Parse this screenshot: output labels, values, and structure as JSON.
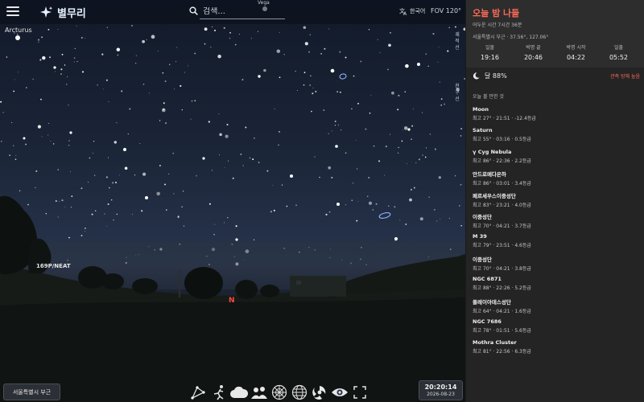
{
  "header": {
    "app_name": "별무리",
    "search_placeholder": "검색...",
    "language": "한국어",
    "fov": "FOV 120°",
    "menu_icon": "hamburger-icon",
    "logo_icon": "sparkle-icon",
    "search_icon": "search-icon",
    "language_icon": "translate-icon"
  },
  "sky": {
    "labels": {
      "arcturus": "Arcturus",
      "comet": "169P/NEAT",
      "vega": "Vega",
      "north": "N"
    },
    "right_edge_text": [
      "궤",
      "적",
      "선",
      "",
      "",
      "",
      "",
      "",
      "천",
      "구",
      "선"
    ]
  },
  "bottom": {
    "location_button": "서울특별시 부근",
    "clock_time": "20:20:14",
    "clock_date": "2026-08-23",
    "toolbar_icons": [
      "constellation-lines-icon",
      "constellation-art-icon",
      "atmosphere-icon",
      "landscape-icon",
      "azimuthal-grid-icon",
      "equatorial-grid-icon",
      "deep-sky-icon",
      "visibility-eye-icon",
      "fullscreen-icon"
    ]
  },
  "panel": {
    "title": "오늘 밤 나들",
    "dark_duration": "어두운 시간 7시간 36분",
    "location_coords": "서울특별시 부근 · 37.56°, 127.06°",
    "times": [
      {
        "label": "일몰",
        "value": "19:16"
      },
      {
        "label": "박명 끝",
        "value": "20:46"
      },
      {
        "label": "박명 시작",
        "value": "04:22"
      },
      {
        "label": "일출",
        "value": "05:52"
      }
    ],
    "moon_icon": "crescent-moon-icon",
    "moon_text": "달 88%",
    "observation_tips": "관측 방해 높음",
    "objects_header": "오늘 볼 만한 것",
    "objects": [
      {
        "name": "Moon",
        "detail": "최고 27° · 21:51 · -12.4등급"
      },
      {
        "name": "Saturn",
        "detail": "최고 55° · 03:16 · 0.5등급"
      },
      {
        "name": "γ Cyg Nebula",
        "detail": "최고 86° · 22:36 · 2.2등급"
      },
      {
        "name": "안드로메다은하",
        "detail": "최고 86° · 03:01 · 3.4등급"
      },
      {
        "name": "페르세우스이중성단",
        "detail": "최고 83° · 23:21 · 4.0등급"
      },
      {
        "name": "이중성단",
        "detail": "최고 70° · 04:21 · 3.7등급"
      },
      {
        "name": "M 39",
        "detail": "최고 79° · 23:51 · 4.6등급"
      },
      {
        "name": "이중성단",
        "detail": "최고 70° · 04:21 · 3.8등급"
      },
      {
        "name": "NGC 6871",
        "detail": "최고 88° · 22:26 · 5.2등급"
      },
      {
        "name": "플레이아데스성단",
        "detail": "최고 64° · 04:21 · 1.6등급"
      },
      {
        "name": "NGC 7686",
        "detail": "최고 78° · 01:51 · 5.6등급"
      },
      {
        "name": "Mothra Cluster",
        "detail": "최고 81° · 22:56 · 6.3등급"
      }
    ]
  },
  "colors": {
    "accent": "#ff6a5a",
    "panel_bg": "#242424"
  }
}
